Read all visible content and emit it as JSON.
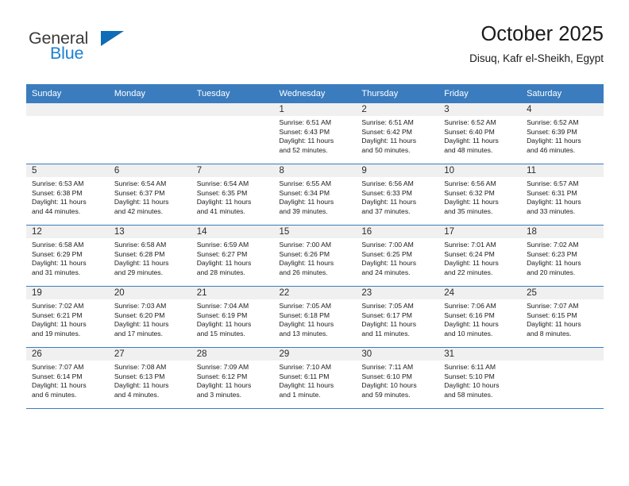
{
  "brand": {
    "name_part1": "General",
    "name_part2": "Blue",
    "triangle_color": "#0f6cb6",
    "blue_color": "#1b80d4"
  },
  "header": {
    "title": "October 2025",
    "subtitle": "Disuq, Kafr el-Sheikh, Egypt",
    "header_bg": "#3a7cbe"
  },
  "weekday_headers": [
    "Sunday",
    "Monday",
    "Tuesday",
    "Wednesday",
    "Thursday",
    "Friday",
    "Saturday"
  ],
  "weeks": [
    [
      {
        "day": "",
        "sunrise": "",
        "sunset": "",
        "daylight1": "",
        "daylight2": ""
      },
      {
        "day": "",
        "sunrise": "",
        "sunset": "",
        "daylight1": "",
        "daylight2": ""
      },
      {
        "day": "",
        "sunrise": "",
        "sunset": "",
        "daylight1": "",
        "daylight2": ""
      },
      {
        "day": "1",
        "sunrise": "Sunrise: 6:51 AM",
        "sunset": "Sunset: 6:43 PM",
        "daylight1": "Daylight: 11 hours",
        "daylight2": "and 52 minutes."
      },
      {
        "day": "2",
        "sunrise": "Sunrise: 6:51 AM",
        "sunset": "Sunset: 6:42 PM",
        "daylight1": "Daylight: 11 hours",
        "daylight2": "and 50 minutes."
      },
      {
        "day": "3",
        "sunrise": "Sunrise: 6:52 AM",
        "sunset": "Sunset: 6:40 PM",
        "daylight1": "Daylight: 11 hours",
        "daylight2": "and 48 minutes."
      },
      {
        "day": "4",
        "sunrise": "Sunrise: 6:52 AM",
        "sunset": "Sunset: 6:39 PM",
        "daylight1": "Daylight: 11 hours",
        "daylight2": "and 46 minutes."
      }
    ],
    [
      {
        "day": "5",
        "sunrise": "Sunrise: 6:53 AM",
        "sunset": "Sunset: 6:38 PM",
        "daylight1": "Daylight: 11 hours",
        "daylight2": "and 44 minutes."
      },
      {
        "day": "6",
        "sunrise": "Sunrise: 6:54 AM",
        "sunset": "Sunset: 6:37 PM",
        "daylight1": "Daylight: 11 hours",
        "daylight2": "and 42 minutes."
      },
      {
        "day": "7",
        "sunrise": "Sunrise: 6:54 AM",
        "sunset": "Sunset: 6:35 PM",
        "daylight1": "Daylight: 11 hours",
        "daylight2": "and 41 minutes."
      },
      {
        "day": "8",
        "sunrise": "Sunrise: 6:55 AM",
        "sunset": "Sunset: 6:34 PM",
        "daylight1": "Daylight: 11 hours",
        "daylight2": "and 39 minutes."
      },
      {
        "day": "9",
        "sunrise": "Sunrise: 6:56 AM",
        "sunset": "Sunset: 6:33 PM",
        "daylight1": "Daylight: 11 hours",
        "daylight2": "and 37 minutes."
      },
      {
        "day": "10",
        "sunrise": "Sunrise: 6:56 AM",
        "sunset": "Sunset: 6:32 PM",
        "daylight1": "Daylight: 11 hours",
        "daylight2": "and 35 minutes."
      },
      {
        "day": "11",
        "sunrise": "Sunrise: 6:57 AM",
        "sunset": "Sunset: 6:31 PM",
        "daylight1": "Daylight: 11 hours",
        "daylight2": "and 33 minutes."
      }
    ],
    [
      {
        "day": "12",
        "sunrise": "Sunrise: 6:58 AM",
        "sunset": "Sunset: 6:29 PM",
        "daylight1": "Daylight: 11 hours",
        "daylight2": "and 31 minutes."
      },
      {
        "day": "13",
        "sunrise": "Sunrise: 6:58 AM",
        "sunset": "Sunset: 6:28 PM",
        "daylight1": "Daylight: 11 hours",
        "daylight2": "and 29 minutes."
      },
      {
        "day": "14",
        "sunrise": "Sunrise: 6:59 AM",
        "sunset": "Sunset: 6:27 PM",
        "daylight1": "Daylight: 11 hours",
        "daylight2": "and 28 minutes."
      },
      {
        "day": "15",
        "sunrise": "Sunrise: 7:00 AM",
        "sunset": "Sunset: 6:26 PM",
        "daylight1": "Daylight: 11 hours",
        "daylight2": "and 26 minutes."
      },
      {
        "day": "16",
        "sunrise": "Sunrise: 7:00 AM",
        "sunset": "Sunset: 6:25 PM",
        "daylight1": "Daylight: 11 hours",
        "daylight2": "and 24 minutes."
      },
      {
        "day": "17",
        "sunrise": "Sunrise: 7:01 AM",
        "sunset": "Sunset: 6:24 PM",
        "daylight1": "Daylight: 11 hours",
        "daylight2": "and 22 minutes."
      },
      {
        "day": "18",
        "sunrise": "Sunrise: 7:02 AM",
        "sunset": "Sunset: 6:23 PM",
        "daylight1": "Daylight: 11 hours",
        "daylight2": "and 20 minutes."
      }
    ],
    [
      {
        "day": "19",
        "sunrise": "Sunrise: 7:02 AM",
        "sunset": "Sunset: 6:21 PM",
        "daylight1": "Daylight: 11 hours",
        "daylight2": "and 19 minutes."
      },
      {
        "day": "20",
        "sunrise": "Sunrise: 7:03 AM",
        "sunset": "Sunset: 6:20 PM",
        "daylight1": "Daylight: 11 hours",
        "daylight2": "and 17 minutes."
      },
      {
        "day": "21",
        "sunrise": "Sunrise: 7:04 AM",
        "sunset": "Sunset: 6:19 PM",
        "daylight1": "Daylight: 11 hours",
        "daylight2": "and 15 minutes."
      },
      {
        "day": "22",
        "sunrise": "Sunrise: 7:05 AM",
        "sunset": "Sunset: 6:18 PM",
        "daylight1": "Daylight: 11 hours",
        "daylight2": "and 13 minutes."
      },
      {
        "day": "23",
        "sunrise": "Sunrise: 7:05 AM",
        "sunset": "Sunset: 6:17 PM",
        "daylight1": "Daylight: 11 hours",
        "daylight2": "and 11 minutes."
      },
      {
        "day": "24",
        "sunrise": "Sunrise: 7:06 AM",
        "sunset": "Sunset: 6:16 PM",
        "daylight1": "Daylight: 11 hours",
        "daylight2": "and 10 minutes."
      },
      {
        "day": "25",
        "sunrise": "Sunrise: 7:07 AM",
        "sunset": "Sunset: 6:15 PM",
        "daylight1": "Daylight: 11 hours",
        "daylight2": "and 8 minutes."
      }
    ],
    [
      {
        "day": "26",
        "sunrise": "Sunrise: 7:07 AM",
        "sunset": "Sunset: 6:14 PM",
        "daylight1": "Daylight: 11 hours",
        "daylight2": "and 6 minutes."
      },
      {
        "day": "27",
        "sunrise": "Sunrise: 7:08 AM",
        "sunset": "Sunset: 6:13 PM",
        "daylight1": "Daylight: 11 hours",
        "daylight2": "and 4 minutes."
      },
      {
        "day": "28",
        "sunrise": "Sunrise: 7:09 AM",
        "sunset": "Sunset: 6:12 PM",
        "daylight1": "Daylight: 11 hours",
        "daylight2": "and 3 minutes."
      },
      {
        "day": "29",
        "sunrise": "Sunrise: 7:10 AM",
        "sunset": "Sunset: 6:11 PM",
        "daylight1": "Daylight: 11 hours",
        "daylight2": "and 1 minute."
      },
      {
        "day": "30",
        "sunrise": "Sunrise: 7:11 AM",
        "sunset": "Sunset: 6:10 PM",
        "daylight1": "Daylight: 10 hours",
        "daylight2": "and 59 minutes."
      },
      {
        "day": "31",
        "sunrise": "Sunrise: 6:11 AM",
        "sunset": "Sunset: 5:10 PM",
        "daylight1": "Daylight: 10 hours",
        "daylight2": "and 58 minutes."
      },
      {
        "day": "",
        "sunrise": "",
        "sunset": "",
        "daylight1": "",
        "daylight2": ""
      }
    ]
  ]
}
